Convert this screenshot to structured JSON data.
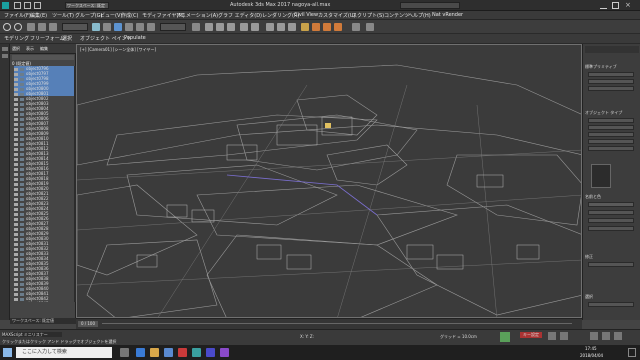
{
  "window": {
    "title": "Autodesk 3ds Max 2017    nagoya-all.max",
    "workspace": "ワークスペース: 既定"
  },
  "menu": {
    "items": [
      "ファイル(F)",
      "編集(E)",
      "ツール(T)",
      "グループ(G)",
      "ビュー(V)",
      "作成(C)",
      "モディファイヤ(M)",
      "アニメーション(A)",
      "グラフ エディタ(D)",
      "レンダリング(R)",
      "Civil View",
      "カスタマイズ(U)",
      "スクリプト(S)",
      "コンテンツ",
      "ヘルプ(H)",
      "Nat vRender"
    ]
  },
  "ribbon": {
    "tabs": [
      "モデリング",
      "フリーフォーム",
      "選択",
      "オブジェクト ペイント",
      "Populate"
    ],
    "label": "ポリゴン モデリング"
  },
  "explorer": {
    "tabs": [
      "選択",
      "表示",
      "編集"
    ],
    "root": "0 (既定値)",
    "rows": [
      "object0796",
      "object0797",
      "object0798",
      "object0799",
      "object0800",
      "object0801",
      "object0802",
      "object0803",
      "object0804",
      "object0805",
      "object0806",
      "object0807",
      "object0808",
      "object0809",
      "object0810",
      "object0811",
      "object0812",
      "object0813",
      "object0814",
      "object0815",
      "object0816",
      "object0817",
      "object0818",
      "object0819",
      "object0820",
      "object0821",
      "object0822",
      "object0823",
      "object0824",
      "object0825",
      "object0826",
      "object0827",
      "object0828",
      "object0829",
      "object0830",
      "object0831",
      "object0832",
      "object0833",
      "object0834",
      "object0835",
      "object0836",
      "object0837",
      "object0838",
      "object0839",
      "object0840",
      "object0841",
      "object0842",
      "object0843"
    ],
    "footer": "ワークスペース: 既定値"
  },
  "viewport": {
    "label": "[+] [Camera01] [シーン全体] [ワイヤー]"
  },
  "cmdpanel": {
    "section1": "標準プリミティブ",
    "section2": "オブジェクト タイプ",
    "section3": "名前と色",
    "section4": "修正",
    "section5": "選択"
  },
  "timeline": {
    "frame": "0 / 100"
  },
  "status": {
    "script": "MAXScript ミニリスナー",
    "message": "クリックまたはクリック アンド ドラッグでオブジェクトを選択",
    "xyz": "X:  Y:  Z:",
    "grid": "グリッド = 10.0cm",
    "keyframe": "キー設定"
  },
  "taskbar": {
    "search": "ここに入力して検索",
    "time": "17:45",
    "date": "2018/04/04"
  }
}
